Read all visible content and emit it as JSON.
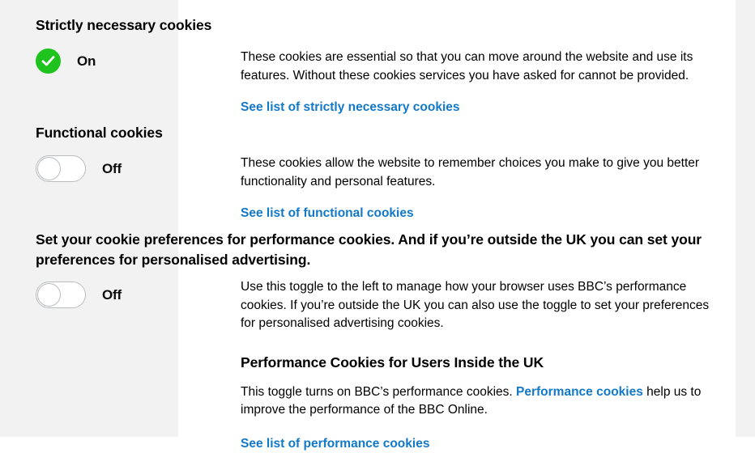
{
  "theme": {
    "panel_bg": "#f2f2f2",
    "page_bg": "#ffffff",
    "link_color": "#1278c8",
    "toggle_on_color": "#1ec31e",
    "toggle_border": "#b9bcbe",
    "text_color": "#000000"
  },
  "sections": [
    {
      "id": "strictly-necessary",
      "heading": "Strictly necessary cookies",
      "toggle": {
        "type": "locked-on",
        "state_label": "On",
        "icon": "check-circle-icon"
      },
      "body": "These cookies are essential so that you can move around the website and use its features. Without these cookies services you have asked for cannot be provided.",
      "link_label": "See list of strictly necessary cookies"
    },
    {
      "id": "functional",
      "heading": "Functional cookies",
      "toggle": {
        "type": "switch",
        "state_label": "Off",
        "icon": "toggle-off-icon"
      },
      "body": "These cookies allow the website to remember choices you make to give you better functionality and personal features.",
      "link_label": "See list of functional cookies"
    },
    {
      "id": "performance",
      "heading": "Set your cookie preferences for performance cookies. And if you’re outside the UK you can set your preferences for personalised advertising.",
      "toggle": {
        "type": "switch",
        "state_label": "Off",
        "icon": "toggle-off-icon"
      },
      "body": "Use this toggle to the left to manage how your browser uses BBC’s performance cookies. If you’re outside the UK you can also use the toggle to set your preferences for personalised advertising cookies.",
      "sub_heading": "Performance Cookies for Users Inside the UK",
      "sub_body_before": "This toggle turns on BBC’s performance cookies. ",
      "sub_body_link": "Performance cookies",
      "sub_body_after": " help us to improve the performance of the BBC Online.",
      "link_label": "See list of performance cookies"
    }
  ]
}
